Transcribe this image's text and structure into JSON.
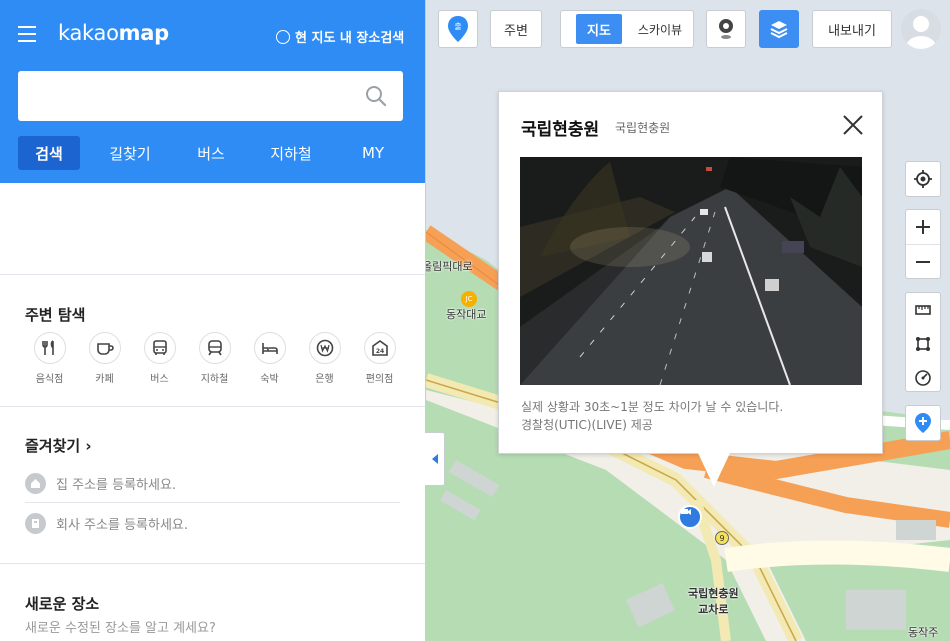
{
  "sidebar": {
    "logo_light": "kakao",
    "logo_bold": "map",
    "area_search_label": "현 지도 내 장소검색",
    "search_placeholder": "",
    "tabs": [
      {
        "label": "검색"
      },
      {
        "label": "길찾기"
      },
      {
        "label": "버스"
      },
      {
        "label": "지하철"
      },
      {
        "label": "MY"
      }
    ],
    "nearby_title": "주변 탐색",
    "categories": [
      {
        "label": "음식점",
        "icon": "restaurant-icon"
      },
      {
        "label": "카페",
        "icon": "cafe-icon"
      },
      {
        "label": "버스",
        "icon": "bus-icon"
      },
      {
        "label": "지하철",
        "icon": "subway-icon"
      },
      {
        "label": "숙박",
        "icon": "lodging-icon"
      },
      {
        "label": "은행",
        "icon": "bank-icon"
      },
      {
        "label": "편의점",
        "icon": "convenience-store-icon"
      }
    ],
    "favorites_title": "즐겨찾기 ›",
    "home_text": "집 주소를 등록하세요.",
    "work_text": "회사 주소를 등록하세요.",
    "new_place_title": "새로운 장소",
    "new_place_desc": "새로운 수정된 장소를 알고 계세요?"
  },
  "toolbar": {
    "start_label": "출",
    "nearby_label": "주변",
    "map_label": "지도",
    "skyview_label": "스카이뷰",
    "export_label": "내보내기"
  },
  "popup": {
    "title": "국립현충원",
    "subtitle": "국립현충원",
    "note": "실제 상황과 30초~1분 정도 차이가 날 수 있습니다.",
    "source": "경찰청(UTIC)(LIVE) 제공"
  },
  "map_labels": {
    "daero": "올림픽대로",
    "jc": "JC",
    "bridge": "동작대교",
    "intersection_line1": "국립현충원",
    "intersection_line2": "교차로",
    "dongjak": "동작주",
    "route_num": "9"
  },
  "colors": {
    "brand_blue": "#2f8cf5",
    "active_tab": "#1c64cf",
    "road_orange": "#f6a055",
    "park_green": "#b6dcb4"
  }
}
